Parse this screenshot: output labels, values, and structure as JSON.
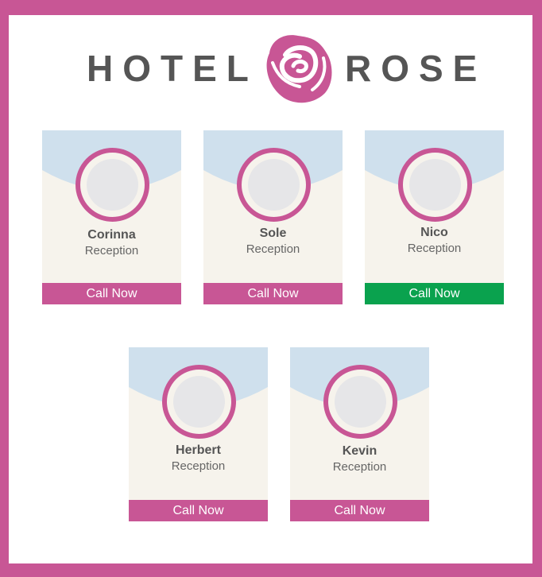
{
  "brand": {
    "left_word": "HOTEL",
    "right_word": "ROSE",
    "logo_icon": "rose-icon"
  },
  "colors": {
    "brand_pink": "#c85695",
    "active_green": "#0aa24e",
    "sky_blue": "#cfe0ed",
    "card_bg": "#f6f3ec",
    "text_gray": "#555555"
  },
  "staff": [
    {
      "name": "Corinna",
      "role": "Reception",
      "cta": "Call Now",
      "status": "default"
    },
    {
      "name": "Sole",
      "role": "Reception",
      "cta": "Call Now",
      "status": "default"
    },
    {
      "name": "Nico",
      "role": "Reception",
      "cta": "Call Now",
      "status": "active"
    },
    {
      "name": "Herbert",
      "role": "Reception",
      "cta": "Call Now",
      "status": "default"
    },
    {
      "name": "Kevin",
      "role": "Reception",
      "cta": "Call Now",
      "status": "default"
    }
  ]
}
